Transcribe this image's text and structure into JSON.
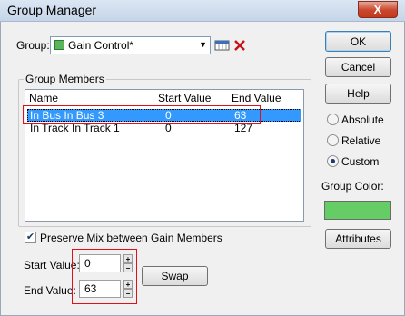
{
  "window": {
    "title": "Group Manager",
    "close_glyph": "X"
  },
  "group": {
    "label": "Group:",
    "selected_value": "Gain Control*",
    "swatch_color": "#5ab55a"
  },
  "members": {
    "title": "Group Members",
    "columns": [
      "Name",
      "Start Value",
      "End Value"
    ],
    "rows": [
      {
        "name": "In Bus In Bus 3",
        "start": "0",
        "end": "63",
        "selected": true
      },
      {
        "name": "In Track In Track 1",
        "start": "0",
        "end": "127",
        "selected": false
      }
    ]
  },
  "preserve_mix": {
    "label": "Preserve Mix between Gain Members",
    "checked": true
  },
  "start_value": {
    "label": "Start Value:",
    "value": "0"
  },
  "end_value": {
    "label": "End Value:",
    "value": "63"
  },
  "buttons": {
    "ok": "OK",
    "cancel": "Cancel",
    "help": "Help",
    "swap": "Swap",
    "attributes": "Attributes"
  },
  "mode": {
    "options": [
      "Absolute",
      "Relative",
      "Custom"
    ],
    "selected": "Custom"
  },
  "group_color": {
    "label": "Group Color:",
    "color": "#66cc66"
  },
  "colors": {
    "selection": "#3399ff",
    "highlight_box": "#e0101a"
  }
}
